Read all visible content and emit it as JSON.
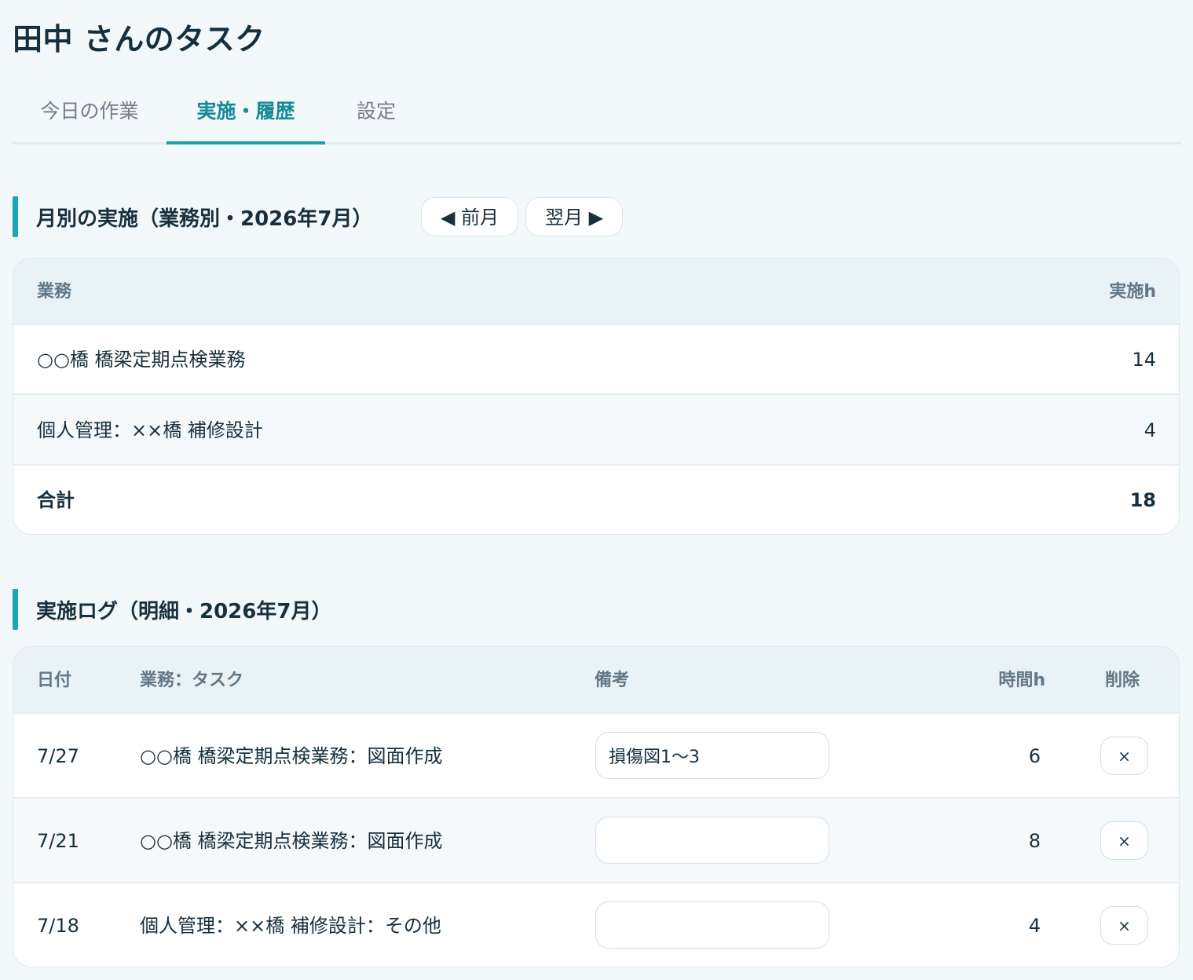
{
  "page": {
    "title": "田中 さんのタスク"
  },
  "tabs": [
    {
      "label": "今日の作業",
      "active": false
    },
    {
      "label": "実施・履歴",
      "active": true
    },
    {
      "label": "設定",
      "active": false
    }
  ],
  "colors": {
    "accent": "#16a3b0",
    "tab_active_text": "#138a95",
    "background": "#f3f8fb",
    "card_header": "#e9f2f6"
  },
  "monthly": {
    "title": "月別の実施（業務別・2026年7月）",
    "prev_label": "◀ 前月",
    "next_label": "翌月 ▶",
    "headers": {
      "business": "業務",
      "hours": "実施h"
    },
    "rows": [
      {
        "business": "○○橋 橋梁定期点検業務",
        "hours": "14"
      },
      {
        "business": "個人管理：××橋 補修設計",
        "hours": "4"
      }
    ],
    "total": {
      "label": "合計",
      "hours": "18"
    }
  },
  "log": {
    "title": "実施ログ（明細・2026年7月）",
    "headers": {
      "date": "日付",
      "task": "業務：タスク",
      "note": "備考",
      "hours": "時間h",
      "delete": "削除"
    },
    "rows": [
      {
        "date": "7/27",
        "task": "○○橋 橋梁定期点検業務：図面作成",
        "note": "損傷図1〜3",
        "hours": "6",
        "delete_label": "×"
      },
      {
        "date": "7/21",
        "task": "○○橋 橋梁定期点検業務：図面作成",
        "note": "",
        "hours": "8",
        "delete_label": "×"
      },
      {
        "date": "7/18",
        "task": "個人管理：××橋 補修設計：その他",
        "note": "",
        "hours": "4",
        "delete_label": "×"
      }
    ]
  }
}
